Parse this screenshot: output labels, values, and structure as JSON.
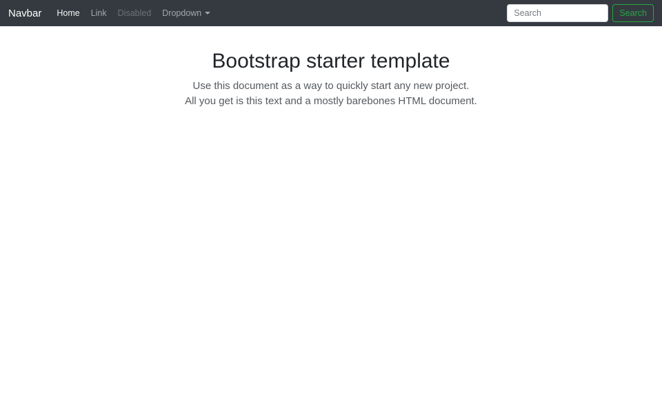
{
  "navbar": {
    "brand": "Navbar",
    "items": [
      {
        "label": "Home",
        "state": "active"
      },
      {
        "label": "Link",
        "state": "default"
      },
      {
        "label": "Disabled",
        "state": "disabled"
      },
      {
        "label": "Dropdown",
        "state": "dropdown"
      }
    ],
    "search": {
      "placeholder": "Search",
      "button_label": "Search"
    },
    "colors": {
      "background": "#343a40",
      "accent_green": "#28a745"
    }
  },
  "main": {
    "title": "Bootstrap starter template",
    "lead_lines": [
      "Use this document as a way to quickly start any new project.",
      "All you get is this text and a mostly barebones HTML document."
    ]
  }
}
